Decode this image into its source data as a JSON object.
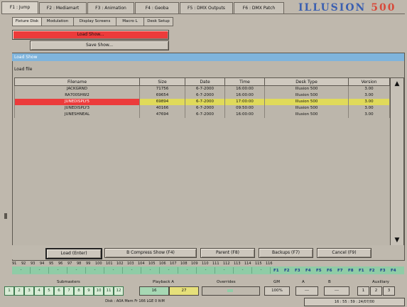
{
  "app": {
    "brand": "ILLUSION",
    "brand_suffix": "500"
  },
  "main_tabs": [
    {
      "label": "F1 : Jump"
    },
    {
      "label": "F2 : Mediamart"
    },
    {
      "label": "F3 : Animation"
    },
    {
      "label": "F4 : Geoba"
    },
    {
      "label": "F5 : DMX Outputs"
    },
    {
      "label": "F6 : DMX Patch"
    }
  ],
  "sub_tabs": [
    {
      "label": "Fixture Disk"
    },
    {
      "label": "Modulation"
    },
    {
      "label": "Display Screens"
    },
    {
      "label": "Macro L"
    },
    {
      "label": "Desk Setup"
    }
  ],
  "menu": {
    "load_show": "Load Show...",
    "save_show": "Save Show..."
  },
  "dialog": {
    "title": "Load Show",
    "label": "Load file",
    "columns": [
      "Filename",
      "Size",
      "Date",
      "Time",
      "Desk Type",
      "Version"
    ],
    "rows": [
      [
        "JACKGRND",
        "71756",
        "6-7-2000",
        "16:00:00",
        "Illusion 500",
        "3.00"
      ],
      [
        "RA700SHW2",
        "69654",
        "6-7-2000",
        "16:00:00",
        "Illusion 500",
        "3.00"
      ],
      [
        "JUNEDISPLY5",
        "69894",
        "6-7-2000",
        "17:00:00",
        "Illusion 500",
        "3.00"
      ],
      [
        "JUNEDISPLY3",
        "40166",
        "6-7-2000",
        "09:50:00",
        "Illusion 500",
        "3.00"
      ],
      [
        "JUNESHNEAL",
        "47694",
        "6-7-2000",
        "16:00:00",
        "Illusion 500",
        "3.00"
      ]
    ],
    "selected_row": 2,
    "buttons": {
      "load": "Load (Enter)",
      "compress": "B Compress Show (F4)",
      "parent": "Parent (F8)",
      "backup": "Backups (F7)",
      "cancel": "Cancel (F9)"
    }
  },
  "channel_numbers": [
    "91",
    "92",
    "93",
    "94",
    "95",
    "96",
    "97",
    "98",
    "99",
    "100",
    "101",
    "102",
    "103",
    "104",
    "105",
    "106",
    "107",
    "108",
    "109",
    "110",
    "111",
    "112",
    "113",
    "114",
    "115",
    "116"
  ],
  "green_values": [
    "-",
    "-",
    "-",
    "-",
    "-",
    "-",
    "-",
    "-",
    "-",
    "-",
    "-",
    "-",
    "-",
    "-",
    "-",
    "-",
    "-",
    "-",
    "-",
    "-",
    "-"
  ],
  "fkeys": [
    "F1",
    "F2",
    "F3",
    "F4",
    "F5",
    "F6",
    "F7",
    "F8",
    "F1",
    "F2",
    "F3",
    "F4"
  ],
  "groups": {
    "submasters": "Submasters",
    "playback": "Playback A",
    "overrides": "Overrides",
    "grand": "GM",
    "a": "A",
    "b": "B",
    "auxiliary": "Auxiliary"
  },
  "sub_numbers": [
    "1",
    "2",
    "3",
    "4",
    "5",
    "6",
    "7",
    "8",
    "9",
    "10",
    "11",
    "12"
  ],
  "playback_values": {
    "a": "16",
    "b": "27"
  },
  "status": {
    "grand": "100%",
    "a": "---",
    "b": "---",
    "aux": [
      "1",
      "2",
      "3"
    ],
    "footer": "Disk : A0A  Mem Fr 166 LGE 0 ItiM",
    "clock": "16 : 55 : 59 : 24/07/00"
  },
  "colors": {
    "titlebar": "#7fb4dc",
    "selected": "#e0da5a",
    "highlight": "#ec3b3b"
  }
}
